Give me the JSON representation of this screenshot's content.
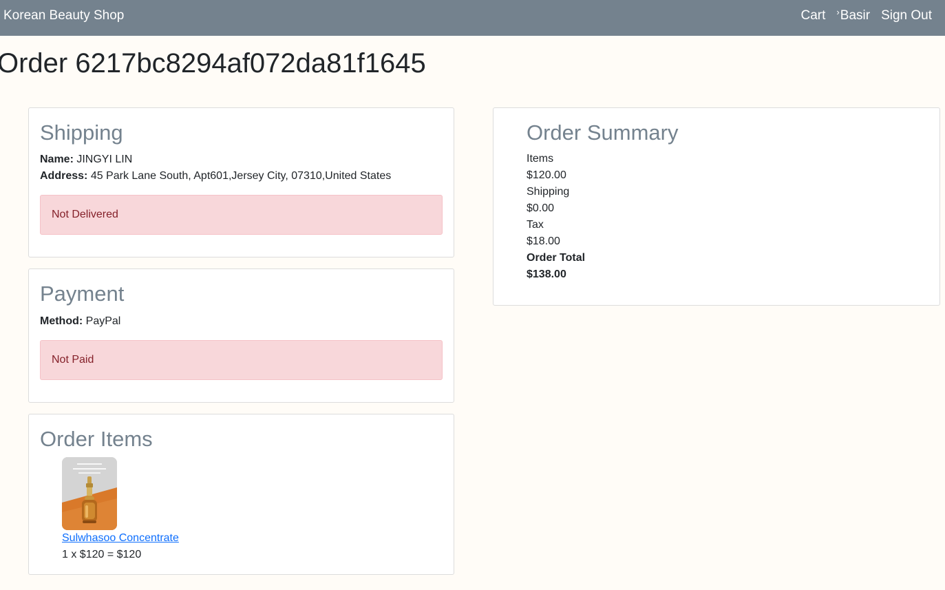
{
  "navbar": {
    "brand": "Korean Beauty Shop",
    "cart_label": "Cart",
    "user_label": "Basir",
    "signout_label": "Sign Out"
  },
  "page": {
    "title": "Order 6217bc8294af072da81f1645"
  },
  "shipping": {
    "heading": "Shipping",
    "name_label": "Name:",
    "name_value": "JINGYI LIN",
    "address_label": "Address:",
    "address_value": "45 Park Lane South, Apt601,Jersey City, 07310,United States",
    "status": "Not Delivered"
  },
  "payment": {
    "heading": "Payment",
    "method_label": "Method:",
    "method_value": "PayPal",
    "status": "Not Paid"
  },
  "order_items": {
    "heading": "Order Items",
    "items": [
      {
        "name": "Sulwhasoo Concentrate",
        "calc": "1 x $120 = $120"
      }
    ]
  },
  "summary": {
    "heading": "Order Summary",
    "items_label": "Items",
    "items_value": "$120.00",
    "shipping_label": "Shipping",
    "shipping_value": "$0.00",
    "tax_label": "Tax",
    "tax_value": "$18.00",
    "total_label": "Order Total",
    "total_value": "$138.00"
  },
  "colors": {
    "navbar": "#74828e",
    "heading": "#74828e",
    "alert_bg": "#f8d7da",
    "alert_text": "#842029",
    "link": "#0d6efd",
    "page_bg": "#fffcf7"
  }
}
